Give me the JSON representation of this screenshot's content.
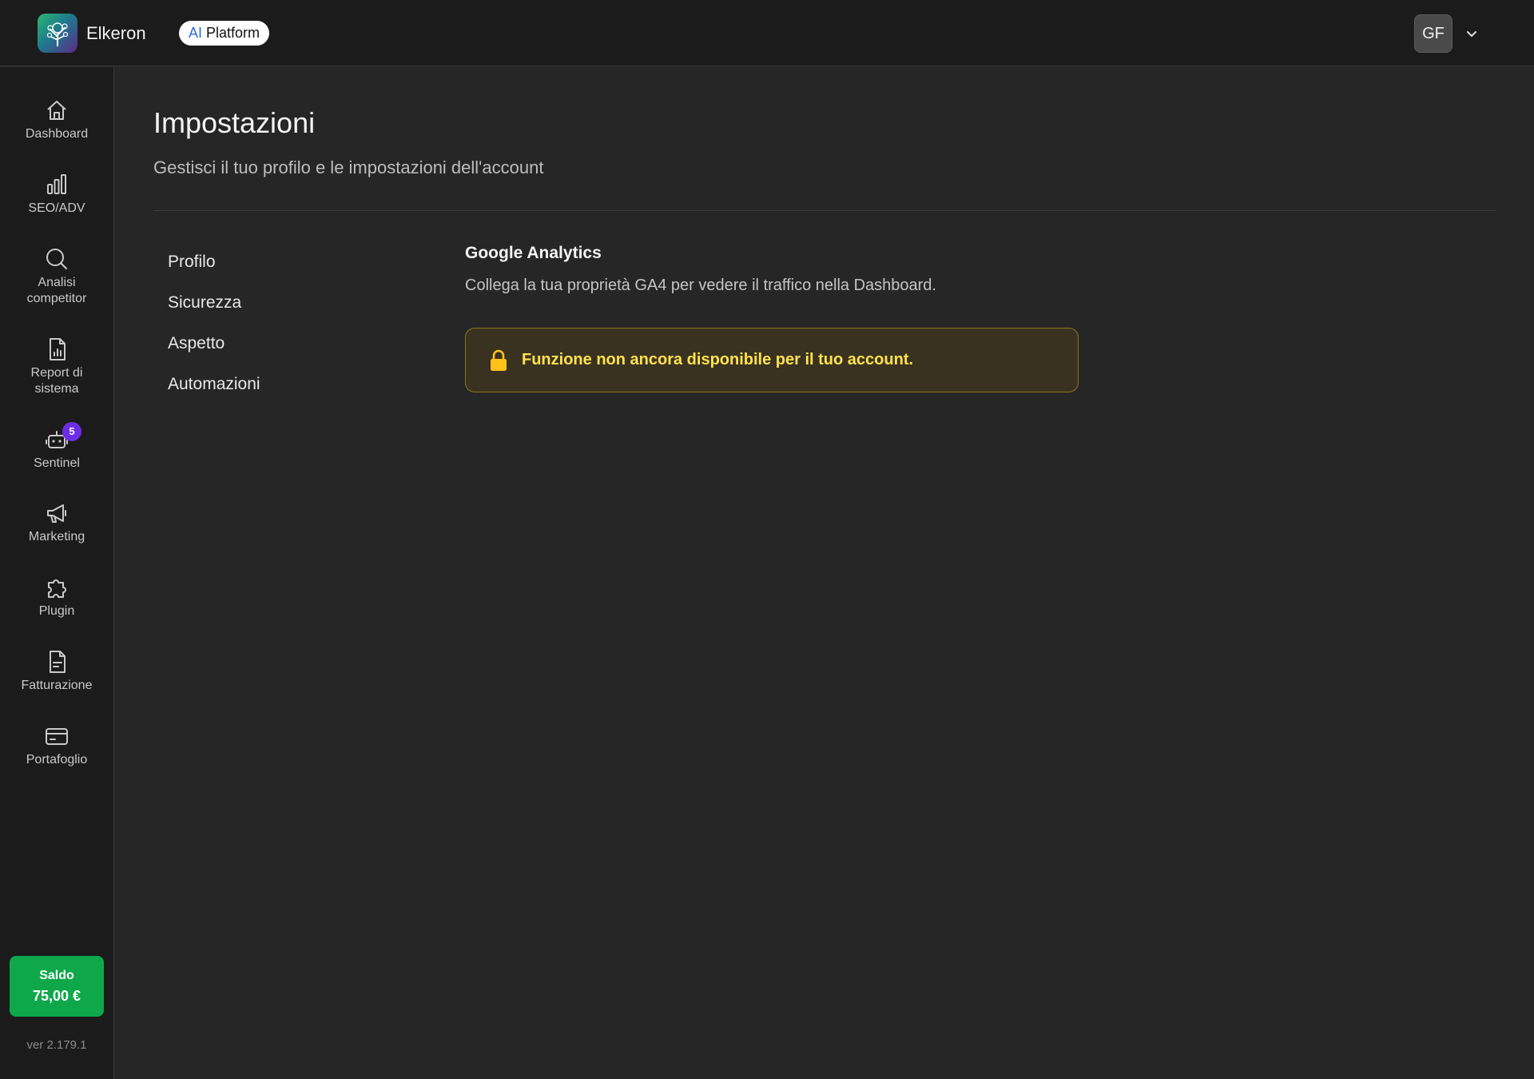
{
  "header": {
    "app_name": "Elkeron",
    "platform_ai": "AI",
    "platform_label": "Platform",
    "user_initials": "GF"
  },
  "sidebar": {
    "items": [
      {
        "label": "Dashboard",
        "icon": "home-icon"
      },
      {
        "label": "SEO/ADV",
        "icon": "bar-chart-icon"
      },
      {
        "label": "Analisi competitor",
        "icon": "search-icon"
      },
      {
        "label": "Report di sistema",
        "icon": "report-file-icon"
      },
      {
        "label": "Sentinel",
        "icon": "robot-icon",
        "badge": "5"
      },
      {
        "label": "Marketing",
        "icon": "megaphone-icon"
      },
      {
        "label": "Plugin",
        "icon": "puzzle-icon"
      },
      {
        "label": "Fatturazione",
        "icon": "invoice-file-icon"
      },
      {
        "label": "Portafoglio",
        "icon": "wallet-card-icon"
      }
    ],
    "saldo_label": "Saldo",
    "saldo_amount": "75,00 €",
    "version": "ver 2.179.1"
  },
  "main": {
    "title": "Impostazioni",
    "subtitle": "Gestisci il tuo profilo e le impostazioni dell'account",
    "settings_nav": [
      "Profilo",
      "Sicurezza",
      "Aspetto",
      "Automazioni"
    ],
    "section_title": "Google Analytics",
    "section_desc": "Collega la tua proprietà GA4 per vedere il traffico nella Dashboard.",
    "warning": "Funzione non ancora disponibile per il tuo account."
  },
  "colors": {
    "background": "#262626",
    "sidebar": "#1b1b1b",
    "saldo_green": "#0ea84a",
    "badge_purple": "#6b2ee6",
    "warning_text": "#ffe24d",
    "warning_bg": "#3a3221",
    "lock_yellow": "#ffc21a"
  }
}
